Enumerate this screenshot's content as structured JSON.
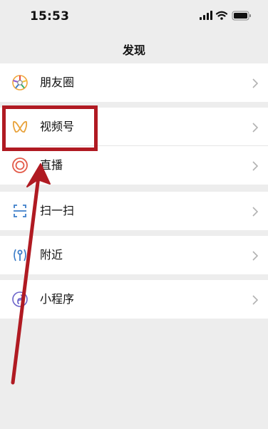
{
  "status_bar": {
    "time": "15:53",
    "icons": [
      "signal-icon",
      "wifi-icon",
      "battery-icon"
    ]
  },
  "header": {
    "title": "发现"
  },
  "menu": {
    "items": [
      {
        "label": "朋友圈",
        "icon": "moments-icon"
      },
      {
        "label": "视频号",
        "icon": "channels-icon"
      },
      {
        "label": "直播",
        "icon": "live-icon"
      },
      {
        "label": "扫一扫",
        "icon": "scan-icon"
      },
      {
        "label": "附近",
        "icon": "nearby-icon"
      },
      {
        "label": "小程序",
        "icon": "mini-program-icon"
      }
    ]
  },
  "colors": {
    "background": "#ededed",
    "annotation": "#b01a22",
    "channels_accent": "#e8a23a",
    "live_accent": "#e35b4a",
    "scan_accent": "#3d7ec9",
    "nearby_accent": "#3d7ec9",
    "mini_program_accent": "#6b63c9"
  }
}
